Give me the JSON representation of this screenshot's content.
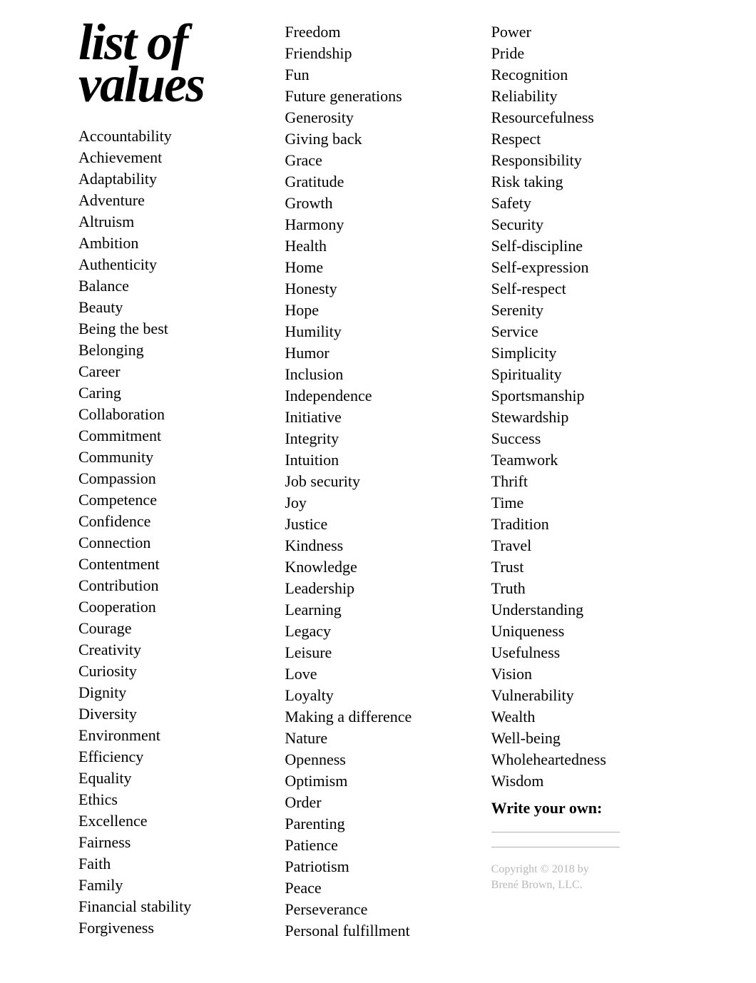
{
  "title_line1": "list of",
  "title_line2": "values",
  "values": [
    "Accountability",
    "Achievement",
    "Adaptability",
    "Adventure",
    "Altruism",
    "Ambition",
    "Authenticity",
    "Balance",
    "Beauty",
    "Being the best",
    "Belonging",
    "Career",
    "Caring",
    "Collaboration",
    "Commitment",
    "Community",
    "Compassion",
    "Competence",
    "Confidence",
    "Connection",
    "Contentment",
    "Contribution",
    "Cooperation",
    "Courage",
    "Creativity",
    "Curiosity",
    "Dignity",
    "Diversity",
    "Environment",
    "Efficiency",
    "Equality",
    "Ethics",
    "Excellence",
    "Fairness",
    "Faith",
    "Family",
    "Financial stability",
    "Forgiveness",
    "Freedom",
    "Friendship",
    "Fun",
    "Future generations",
    "Generosity",
    "Giving back",
    "Grace",
    "Gratitude",
    "Growth",
    "Harmony",
    "Health",
    "Home",
    "Honesty",
    "Hope",
    "Humility",
    "Humor",
    "Inclusion",
    "Independence",
    "Initiative",
    "Integrity",
    "Intuition",
    "Job security",
    "Joy",
    "Justice",
    "Kindness",
    "Knowledge",
    "Leadership",
    "Learning",
    "Legacy",
    "Leisure",
    "Love",
    "Loyalty",
    "Making a difference",
    "Nature",
    "Openness",
    "Optimism",
    "Order",
    "Parenting",
    "Patience",
    "Patriotism",
    "Peace",
    "Perseverance",
    "Personal fulfillment",
    "Power",
    "Pride",
    "Recognition",
    "Reliability",
    "Resourcefulness",
    "Respect",
    "Responsibility",
    "Risk taking",
    "Safety",
    "Security",
    "Self-discipline",
    "Self-expression",
    "Self-respect",
    "Serenity",
    "Service",
    "Simplicity",
    "Spirituality",
    "Sportsmanship",
    "Stewardship",
    "Success",
    "Teamwork",
    "Thrift",
    "Time",
    "Tradition",
    "Travel",
    "Trust",
    "Truth",
    "Understanding",
    "Uniqueness",
    "Usefulness",
    "Vision",
    "Vulnerability",
    "Wealth",
    "Well-being",
    "Wholeheartedness",
    "Wisdom"
  ],
  "write_your_own_label": "Write your own:",
  "copyright_line1": "Copyright © 2018 by",
  "copyright_line2": "Brené Brown, LLC."
}
